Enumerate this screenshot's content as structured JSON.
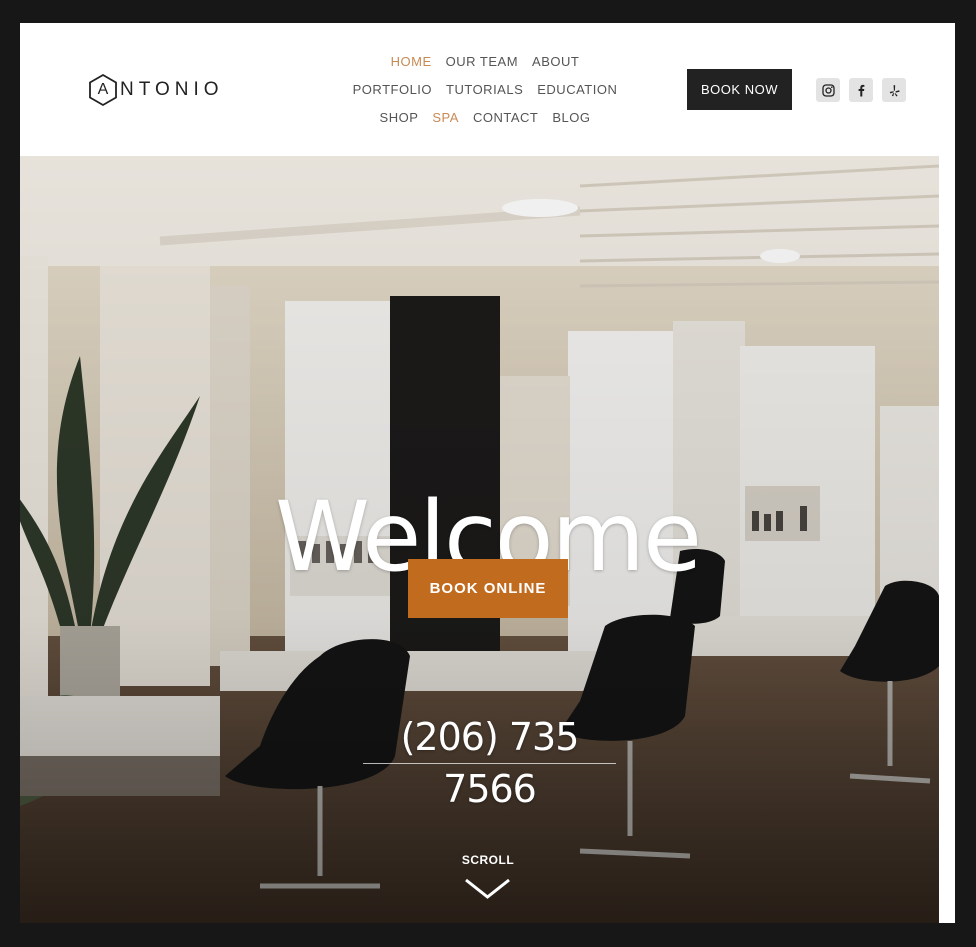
{
  "brand": {
    "logo_letter": "A",
    "logo_rest": "NTONIO"
  },
  "nav": {
    "rows": [
      [
        {
          "label": "HOME",
          "active": true
        },
        {
          "label": "OUR TEAM"
        },
        {
          "label": "ABOUT"
        }
      ],
      [
        {
          "label": "PORTFOLIO"
        },
        {
          "label": "TUTORIALS"
        },
        {
          "label": "EDUCATION"
        }
      ],
      [
        {
          "label": "SHOP"
        },
        {
          "label": "SPA",
          "active": true
        },
        {
          "label": "CONTACT"
        },
        {
          "label": "BLOG"
        }
      ]
    ]
  },
  "header": {
    "book_now_label": "BOOK NOW"
  },
  "socials": [
    {
      "icon": "instagram-icon"
    },
    {
      "icon": "facebook-icon"
    },
    {
      "icon": "yelp-icon"
    }
  ],
  "hero": {
    "headline": "Welcome",
    "cta_label": "BOOK ONLINE",
    "phone": "(206) 735 7566",
    "scroll_label": "SCROLL"
  },
  "colors": {
    "accent_nav": "#c88a55",
    "cta_background": "#c16b1f",
    "book_now_background": "#222222",
    "page_background": "#171717"
  }
}
